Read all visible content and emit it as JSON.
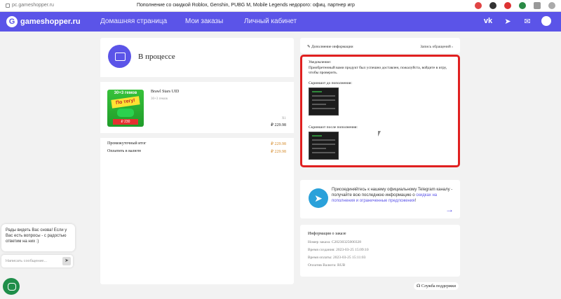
{
  "browser": {
    "url": "pc.gameshopper.ru",
    "title": "Пополнение со скидкой Roblox, Genshin, PUBG M, Mobile Legends недорого: офиц. партнер игр",
    "extensions": [
      "extension-red-icon",
      "extension-dark-icon",
      "extension-red2-icon",
      "extension-green-icon",
      "extension-puzzle-icon",
      "profile-icon"
    ]
  },
  "nav": {
    "logo_text": "gameshopper.ru",
    "links": [
      "Домашняя страница",
      "Мои заказы",
      "Личный кабинет"
    ],
    "icons": [
      "vk-icon",
      "telegram-icon",
      "mail-icon",
      "user-icon"
    ],
    "accent": "#5b54e8"
  },
  "order": {
    "status": "В процессе",
    "product_name": "Brawl Stars UID",
    "product_desc": "30+3 гемов",
    "product_qty": "X1",
    "product_price": "₽ 229.98",
    "image": {
      "top_text": "30+3 гемов",
      "banner": "По тегу!",
      "price": "₽ 230"
    },
    "subtotal_label": "Промежуточный итог",
    "subtotal_value": "₽ 229.98",
    "pay_label": "Оплатить в валюте",
    "pay_value": "₽ 229.98"
  },
  "right": {
    "extra_info_label": "✎ Дополнение информации",
    "appeals_label": "Запись обращений ›",
    "notice_title": "Уведомление:",
    "notice_text": "Приобретенный вами продукт был успешно доставлен, пожалуйста, войдите в игру, чтобы проверить.",
    "before_label": "Скриншот до пополнения:",
    "after_label": "Скриншот после пополнения:",
    "telegram_text_1": "Присоединяйтесь к нашему официальному Telegram каналу - получайте всю последнюю информацию о ",
    "telegram_link": "скидках на пополнения и ограниченные предложения",
    "telegram_text_2": "!",
    "order_info_title": "Информация о заказе",
    "order_number": "Номер заказа:   C20230325000328",
    "created": "Время создания:   2023-03-25 15:09:10",
    "paid": "Время оплаты:   2023-03-25 15:11:03",
    "currency": "Оплатив Валюта:   RUB",
    "support": "Служба поддержки"
  },
  "chat": {
    "greeting": "Рады видеть Вас снова! Если у Вас есть вопросы - с радостью ответим на них :)",
    "placeholder": "Написать сообщение..."
  }
}
